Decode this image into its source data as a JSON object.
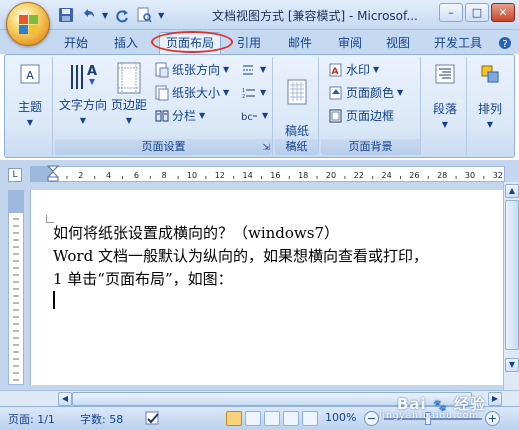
{
  "window": {
    "title": "文档视图方式 [兼容模式] - Microsof...",
    "minimize": "–",
    "maximize": "□",
    "close": "✕"
  },
  "tabs": [
    {
      "label": "开始"
    },
    {
      "label": "插入"
    },
    {
      "label": "页面布局"
    },
    {
      "label": "引用"
    },
    {
      "label": "邮件"
    },
    {
      "label": "审阅"
    },
    {
      "label": "视图"
    },
    {
      "label": "开发工具"
    }
  ],
  "ribbon": {
    "theme": {
      "label": "主题"
    },
    "page_setup": {
      "label": "页面设置",
      "text_direction": "文字方向",
      "margins": "页边距",
      "orientation": "纸张方向",
      "size": "纸张大小",
      "columns": "分栏"
    },
    "paper": {
      "label": "稿纸",
      "button": "稿纸\n设置"
    },
    "page_background": {
      "label": "页面背景",
      "watermark": "水印",
      "page_color": "页面颜色",
      "page_borders": "页面边框"
    },
    "paragraph": {
      "label": "段落"
    },
    "arrange": {
      "label": "排列"
    }
  },
  "ruler": {
    "corner": "L",
    "numbers": [
      "2",
      "4",
      "6",
      "8",
      "10",
      "12",
      "14",
      "16",
      "18",
      "20",
      "22",
      "24",
      "26",
      "28",
      "30",
      "32"
    ]
  },
  "document": {
    "lines": [
      "如何将纸张设置成横向的？（windows7）",
      "Word 文档一般默认为纵向的，如果想横向查看或打印，",
      "1 单击“页面布局”，如图："
    ]
  },
  "statusbar": {
    "page": "页面: 1/1",
    "words": "字数: 58",
    "zoom": "100%",
    "zoom_level": 1.0
  },
  "watermark": {
    "brand": "Bai",
    "brand2": "经验",
    "domain": "jingyan.baidu.com"
  },
  "colors": {
    "accent": "#15428b",
    "highlight_circle": "#e0312b",
    "ribbon_bg": "#dbe8f7"
  }
}
